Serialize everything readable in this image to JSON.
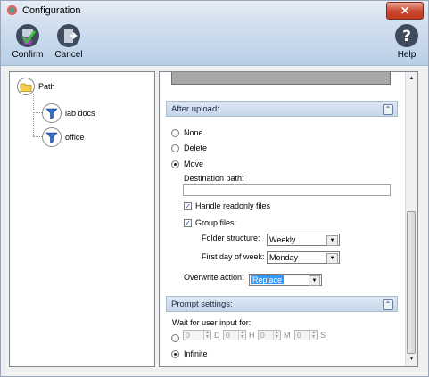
{
  "window": {
    "title": "Configuration",
    "close_symbol": "✕"
  },
  "toolbar": {
    "confirm_label": "Confirm",
    "cancel_label": "Cancel",
    "help_label": "Help"
  },
  "tree": {
    "root_label": "Path",
    "children": [
      "lab docs",
      "office"
    ]
  },
  "after_upload": {
    "header": "After upload:",
    "options": [
      "None",
      "Delete",
      "Move"
    ],
    "selected": "Move",
    "destination_label": "Destination path:",
    "destination_value": "",
    "handle_readonly_label": "Handle readonly files",
    "handle_readonly_checked": true,
    "group_files_label": "Group files:",
    "group_files_checked": true,
    "folder_structure_label": "Folder structure:",
    "folder_structure_value": "Weekly",
    "first_day_label": "First day of week:",
    "first_day_value": "Monday",
    "overwrite_label": "Overwrite action:",
    "overwrite_value": "Replace"
  },
  "prompt_settings": {
    "header": "Prompt settings:",
    "wait_label": "Wait for user input for:",
    "d_value": "0",
    "d_unit": "D",
    "h_value": "0",
    "h_unit": "H",
    "m_value": "0",
    "m_unit": "M",
    "s_value": "0",
    "s_unit": "S",
    "infinite_label": "Infinite",
    "selected": "Infinite"
  },
  "icons": {
    "collapse": "⌃",
    "dropdown": "▼",
    "check": "✓",
    "scroll_up": "▲",
    "scroll_down": "▼",
    "spin_up": "▲",
    "spin_down": "▼"
  }
}
